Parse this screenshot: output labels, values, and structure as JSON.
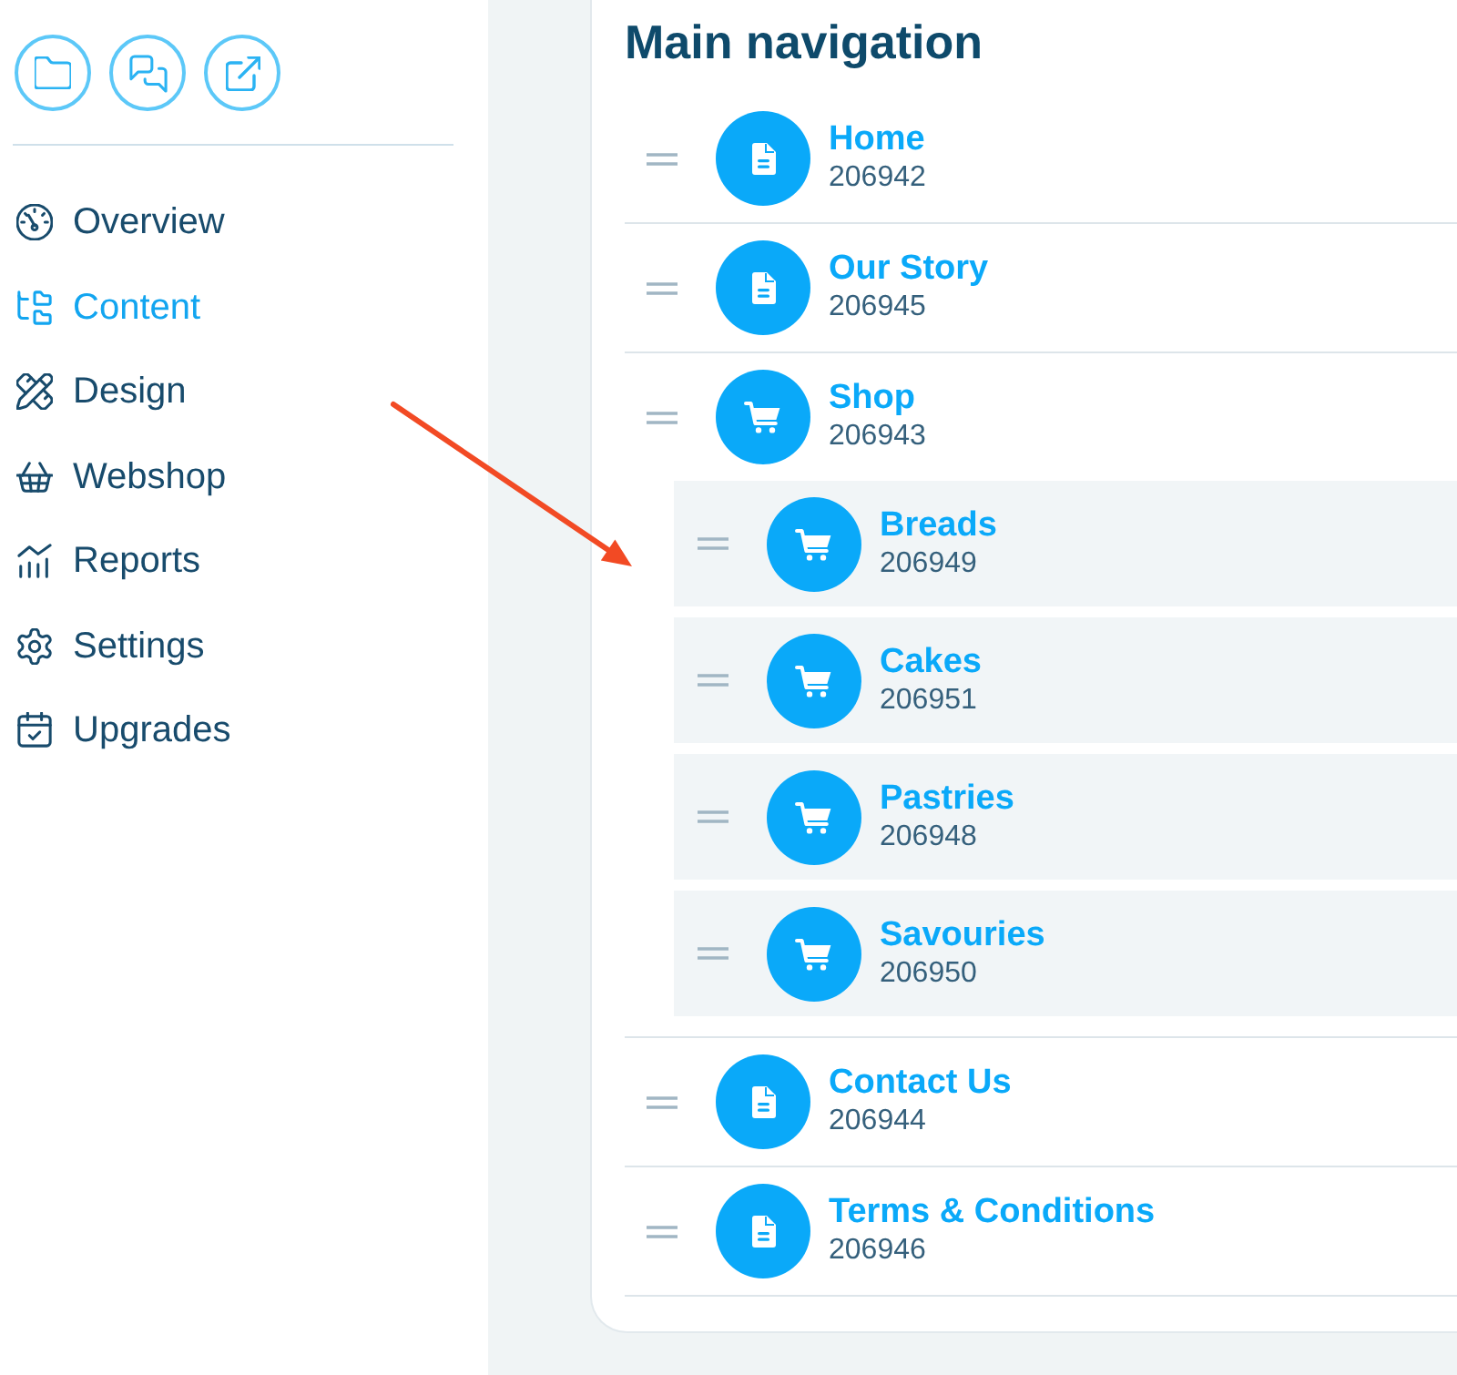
{
  "sidebar": {
    "items": [
      {
        "label": "Overview",
        "selected": false
      },
      {
        "label": "Content",
        "selected": true
      },
      {
        "label": "Design",
        "selected": false
      },
      {
        "label": "Webshop",
        "selected": false
      },
      {
        "label": "Reports",
        "selected": false
      },
      {
        "label": "Settings",
        "selected": false
      },
      {
        "label": "Upgrades",
        "selected": false
      }
    ]
  },
  "navigation": {
    "title": "Main navigation",
    "items": [
      {
        "kind": "page",
        "title": "Home",
        "id": "206942"
      },
      {
        "kind": "page",
        "title": "Our Story",
        "id": "206945"
      },
      {
        "kind": "shop",
        "title": "Shop",
        "id": "206943",
        "children": [
          {
            "kind": "shop",
            "title": "Breads",
            "id": "206949"
          },
          {
            "kind": "shop",
            "title": "Cakes",
            "id": "206951"
          },
          {
            "kind": "shop",
            "title": "Pastries",
            "id": "206948"
          },
          {
            "kind": "shop",
            "title": "Savouries",
            "id": "206950"
          }
        ]
      },
      {
        "kind": "page",
        "title": "Contact Us",
        "id": "206944"
      },
      {
        "kind": "page",
        "title": "Terms & Conditions",
        "id": "206946"
      }
    ]
  }
}
